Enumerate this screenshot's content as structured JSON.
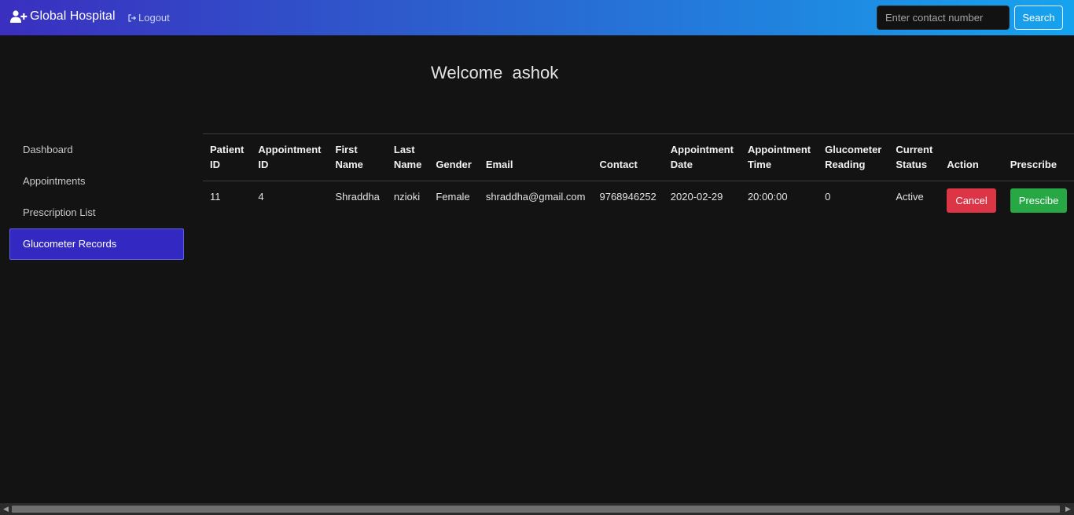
{
  "navbar": {
    "brand": "Global Hospital",
    "brand_icon": "user-plus-icon",
    "logout_label": "Logout",
    "logout_icon": "sign-out-icon",
    "search_placeholder": "Enter contact number",
    "search_value": "",
    "search_button": "Search"
  },
  "welcome": {
    "text": "Welcome  ashok"
  },
  "sidebar": {
    "items": [
      {
        "label": "Dashboard",
        "active": false
      },
      {
        "label": "Appointments",
        "active": false
      },
      {
        "label": "Prescription List",
        "active": false
      },
      {
        "label": "Glucometer Records",
        "active": true
      }
    ],
    "active_color": "#3328c2"
  },
  "table": {
    "columns": [
      [
        "Patient",
        "ID"
      ],
      [
        "Appointment",
        "ID"
      ],
      [
        "First",
        "Name"
      ],
      [
        "Last",
        "Name"
      ],
      [
        "",
        "Gender"
      ],
      [
        "",
        "Email"
      ],
      [
        "",
        "Contact"
      ],
      [
        "Appointment",
        "Date"
      ],
      [
        "Appointment",
        "Time"
      ],
      [
        "Glucometer",
        "Reading"
      ],
      [
        "Current",
        "Status"
      ],
      [
        "",
        "Action"
      ],
      [
        "",
        "Prescribe"
      ]
    ],
    "rows": [
      {
        "patient_id": "11",
        "appointment_id": "4",
        "first_name": "Shraddha",
        "last_name": "nzioki",
        "gender": "Female",
        "email": "shraddha@gmail.com",
        "contact": "9768946252",
        "appointment_date": "2020-02-29",
        "appointment_time": "20:00:00",
        "glucometer_reading": "0",
        "current_status": "Active",
        "action_button": "Cancel",
        "prescribe_button": "Prescibe"
      }
    ]
  },
  "colors": {
    "background": "#131313",
    "danger": "#dc3545",
    "success": "#28a745",
    "navbar_gradient_start": "#3a2fc0",
    "navbar_gradient_end": "#16a3ee"
  }
}
